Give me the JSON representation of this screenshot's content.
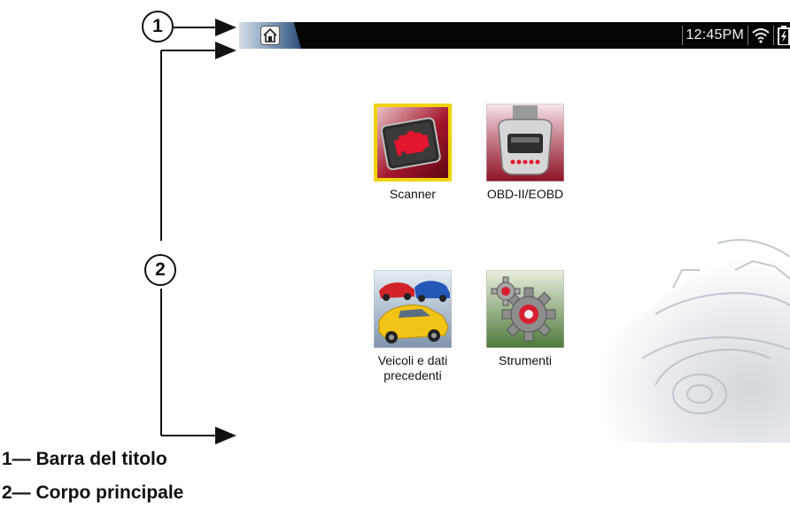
{
  "annotations": {
    "callout_1": "1",
    "callout_2": "2"
  },
  "titlebar": {
    "time": "12:45PM",
    "home_icon": "home-icon",
    "wifi_icon": "wifi-icon",
    "battery_icon": "battery-icon"
  },
  "apps": {
    "scanner": {
      "label": "Scanner",
      "icon": "engine-icon"
    },
    "obd": {
      "label": "OBD-II/EOBD",
      "icon": "obd-connector-icon"
    },
    "vehicles": {
      "label_line1": "Veicoli e dati",
      "label_line2": "precedenti",
      "icon": "cars-icon"
    },
    "tools": {
      "label": "Strumenti",
      "icon": "gears-icon"
    }
  },
  "legend": {
    "item1": "1— Barra del titolo",
    "item2": "2— Corpo principale"
  },
  "colors": {
    "titlebar_bg": "#050505",
    "scanner_frame": "#f1d10a",
    "accent_red": "#c8102e"
  }
}
